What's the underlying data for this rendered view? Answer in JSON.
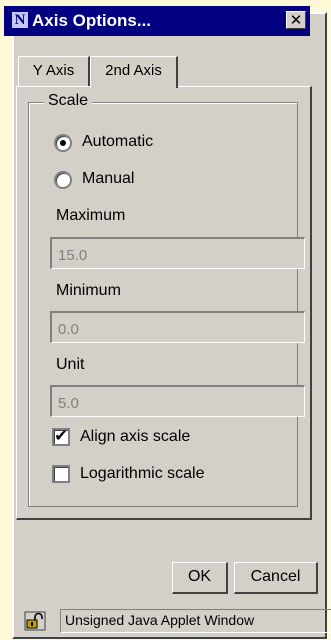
{
  "window": {
    "title": "Axis Options...",
    "app_icon": "netscape-n-icon",
    "close_label": "✕"
  },
  "tabs": [
    {
      "label": "Y Axis",
      "active": false
    },
    {
      "label": "2nd Axis",
      "active": true
    }
  ],
  "scale": {
    "group_label": "Scale",
    "mode_options": [
      {
        "label": "Automatic",
        "selected": true
      },
      {
        "label": "Manual",
        "selected": false
      }
    ],
    "maximum": {
      "label": "Maximum",
      "value": "15.0"
    },
    "minimum": {
      "label": "Minimum",
      "value": "0.0"
    },
    "unit": {
      "label": "Unit",
      "value": "5.0"
    },
    "align_axis_scale": {
      "label": "Align axis scale",
      "checked": true
    },
    "logarithmic_scale": {
      "label": "Logarithmic scale",
      "checked": false
    }
  },
  "buttons": {
    "ok": "OK",
    "cancel": "Cancel"
  },
  "status": {
    "text": "Unsigned Java Applet Window",
    "icon": "unlocked-padlock-icon"
  }
}
